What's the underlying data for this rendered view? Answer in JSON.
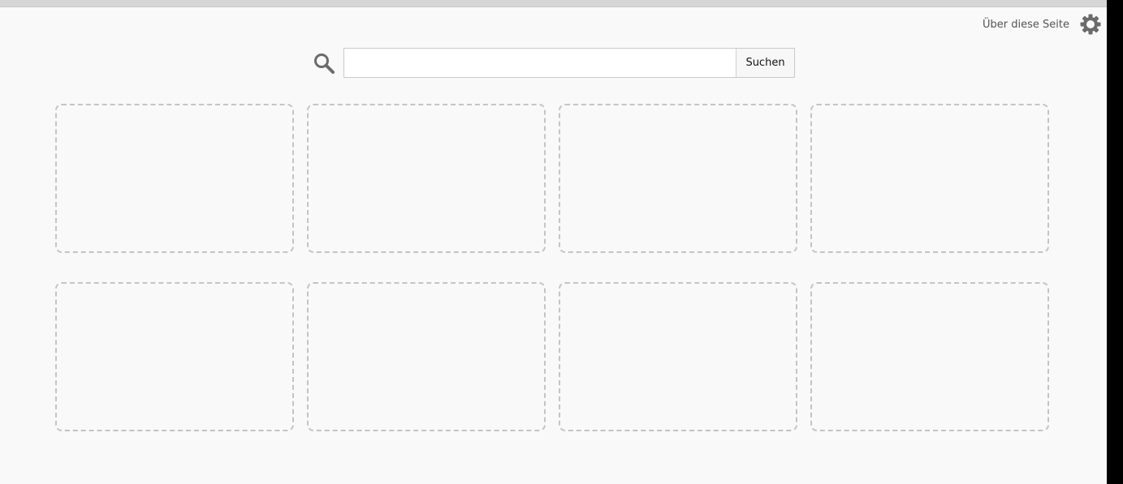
{
  "header": {
    "about_link": "Über diese Seite",
    "settings_icon": "gear-icon"
  },
  "search": {
    "icon": "search-icon",
    "value": "",
    "button_label": "Suchen"
  },
  "tiles": {
    "rows": 2,
    "columns": 4,
    "state": "empty"
  },
  "colors": {
    "background": "#f9f9f9",
    "tile_border": "#c4c4c4",
    "icon": "#6b6b6b"
  }
}
